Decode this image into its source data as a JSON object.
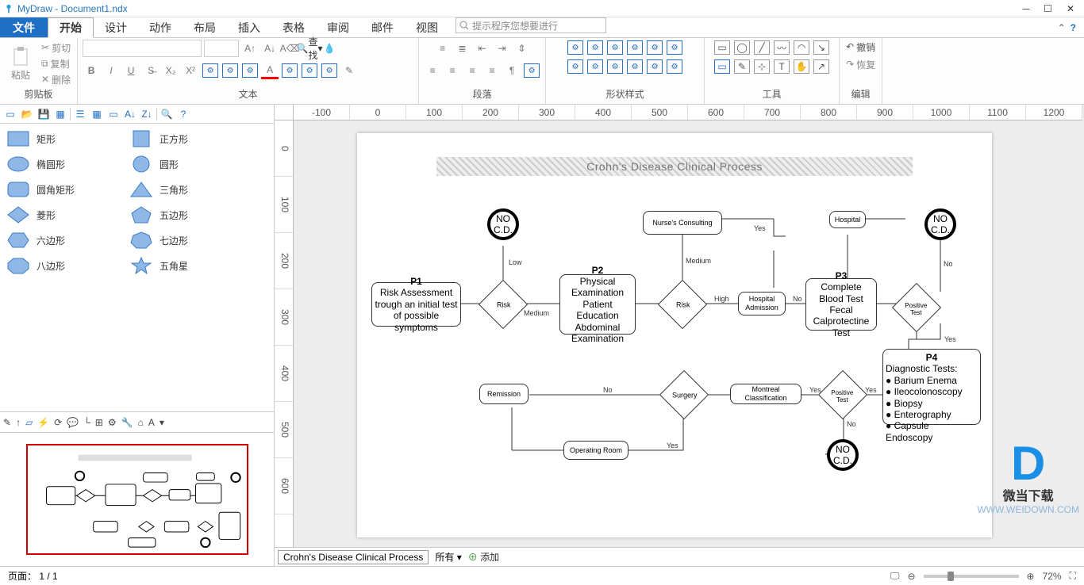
{
  "title": "MyDraw - Document1.ndx",
  "menu": {
    "file": "文件",
    "tabs": [
      "开始",
      "设计",
      "动作",
      "布局",
      "插入",
      "表格",
      "审阅",
      "邮件",
      "视图"
    ],
    "active": 0,
    "search": "提示程序您想要进行"
  },
  "ribbon": {
    "clipboard": {
      "label": "剪贴板",
      "paste": "粘贴",
      "cut": "剪切",
      "copy": "复制",
      "delete": "删除"
    },
    "text": {
      "label": "文本",
      "find": "查找"
    },
    "paragraph": {
      "label": "段落"
    },
    "shapestyle": {
      "label": "形状样式"
    },
    "tools": {
      "label": "工具"
    },
    "edit": {
      "label": "编辑",
      "undo": "撤销",
      "redo": "恢复"
    }
  },
  "shapes": [
    {
      "l": "矩形",
      "r": "正方形"
    },
    {
      "l": "椭圆形",
      "r": "圆形"
    },
    {
      "l": "圆角矩形",
      "r": "三角形"
    },
    {
      "l": "菱形",
      "r": "五边形"
    },
    {
      "l": "六边形",
      "r": "七边形"
    },
    {
      "l": "八边形",
      "r": "五角星"
    }
  ],
  "diagram": {
    "title": "Crohn's Disease Clinical Process",
    "p1": {
      "t": "P1",
      "b": "Risk Assessment trough an initial test of possible symptoms"
    },
    "p2": {
      "t": "P2",
      "b": "Physical Examination\nPatient Education\nAbdominal Examination"
    },
    "p3": {
      "t": "P3",
      "b": "Complete Blood Test\nFecal Calprotectine Test"
    },
    "p4": {
      "t": "P4",
      "b": "Diagnostic Tests:\n● Barium Enema\n● Ileocolonoscopy\n● Biopsy\n● Enterography\n● Capsule Endoscopy"
    },
    "nurse": "Nurse's Consulting",
    "hospital": "Hospital",
    "hosp_adm": "Hospital Admission",
    "remission": "Remission",
    "surgery": "Surgery",
    "montreal": "Montreal Classification",
    "oproom": "Operating Room",
    "risk": "Risk",
    "ptest": "Positive Test",
    "nocd": "NO C.D.",
    "low": "Low",
    "medium": "Medium",
    "high": "High",
    "yes": "Yes",
    "no": "No"
  },
  "sheet": {
    "name": "Crohn's Disease Clinical Process",
    "all": "所有",
    "add": "添加"
  },
  "status": {
    "page": "页面： 1 / 1",
    "zoom": "72%"
  },
  "ruler_h": [
    "-100",
    "0",
    "100",
    "200",
    "300",
    "400",
    "500",
    "600",
    "700",
    "800",
    "900",
    "1000",
    "1100",
    "1200"
  ],
  "ruler_v": [
    "0",
    "100",
    "200",
    "300",
    "400",
    "500",
    "600"
  ],
  "watermark": {
    "brand": "微当下载",
    "url": "WWW.WEIDOWN.COM"
  }
}
